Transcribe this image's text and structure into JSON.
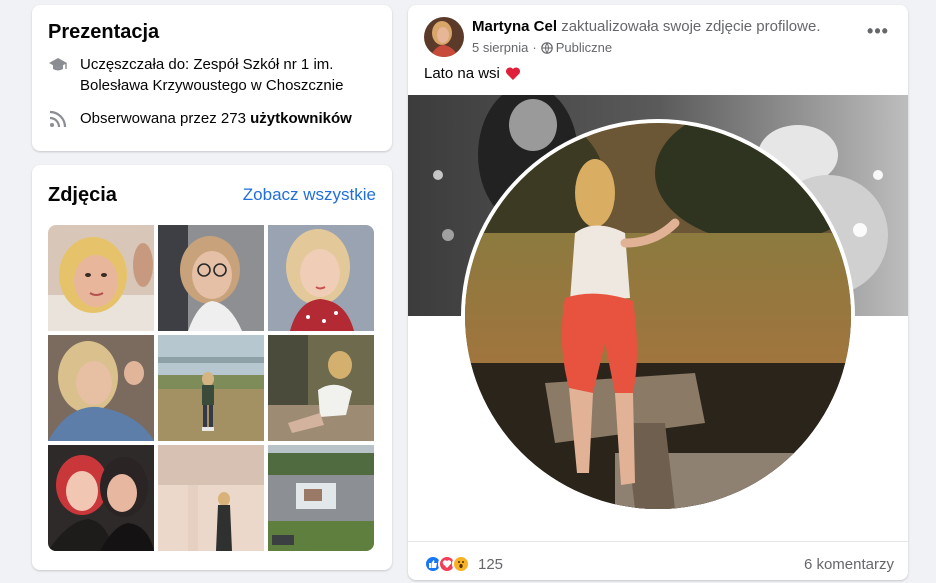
{
  "intro": {
    "title": "Prezentacja",
    "school_prefix": "Uczęszczała do: ",
    "school_name_line1": "Zespół Szkół nr 1 im.",
    "school_name_line2": "Bolesława Krzywoustego w Choszcznie",
    "followers_prefix": "Obserwowana przez ",
    "followers_count": "273",
    "followers_suffix": "użytkowników",
    "school_icon": "graduation-cap-icon",
    "followers_icon": "rss-icon"
  },
  "photos": {
    "title": "Zdjęcia",
    "see_all": "Zobacz wszystkie",
    "items": [
      {
        "name": "photo-1"
      },
      {
        "name": "photo-2"
      },
      {
        "name": "photo-3"
      },
      {
        "name": "photo-4"
      },
      {
        "name": "photo-5"
      },
      {
        "name": "photo-6"
      },
      {
        "name": "photo-7"
      },
      {
        "name": "photo-8"
      },
      {
        "name": "photo-9"
      }
    ]
  },
  "post": {
    "author": "Martyna Cel",
    "action": "zaktualizowała swoje zdjęcie profilowe.",
    "date": "5 sierpnia",
    "separator": "·",
    "audience": "Publiczne",
    "more": "•••",
    "text": "Lato na wsi",
    "reactions_count": "125",
    "comments": "6 komentarzy"
  },
  "colors": {
    "background": "#f0f2f5",
    "link": "#216fdb",
    "secondary_text": "#65676b",
    "like_blue": "#1877f2",
    "love_red": "#f33e58",
    "wow_yellow": "#f7b125"
  }
}
